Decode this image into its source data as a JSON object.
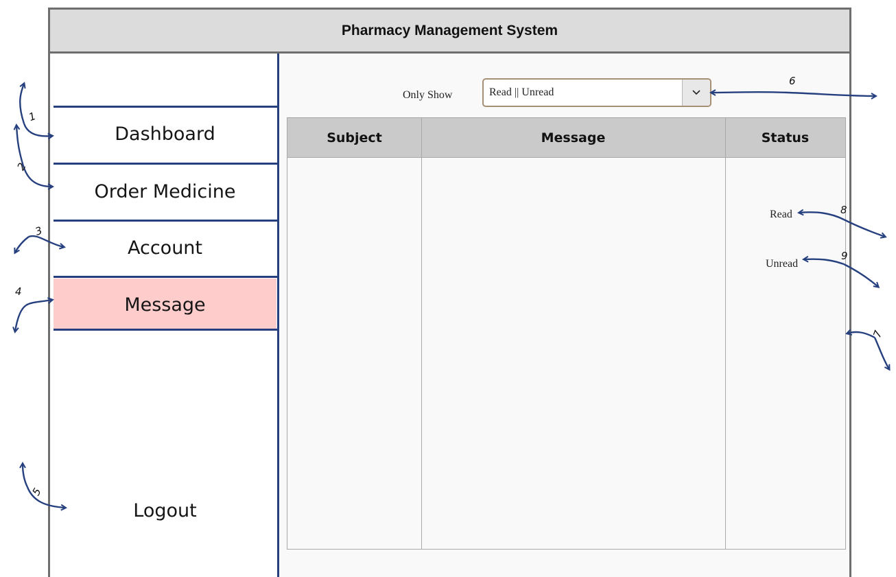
{
  "app": {
    "title": "Pharmacy Management System"
  },
  "sidebar": {
    "items": [
      {
        "label": "Dashboard"
      },
      {
        "label": "Order Medicine"
      },
      {
        "label": "Account"
      },
      {
        "label": "Message",
        "active": true
      },
      {
        "label": "Logout"
      }
    ]
  },
  "filter": {
    "label": "Only Show",
    "value": "Read || Unread",
    "button_icon": "chevron-down-icon"
  },
  "table": {
    "columns": [
      "Subject",
      "Message",
      "Status"
    ],
    "rows": [],
    "status_options": [
      "Read",
      "Unread"
    ]
  },
  "annotations": [
    "1",
    "2",
    "3",
    "4",
    "5",
    "6",
    "7",
    "8",
    "9"
  ],
  "colors": {
    "annotation": "#26407f",
    "active_nav": "#ffcccc",
    "header": "#dcdcdc"
  }
}
